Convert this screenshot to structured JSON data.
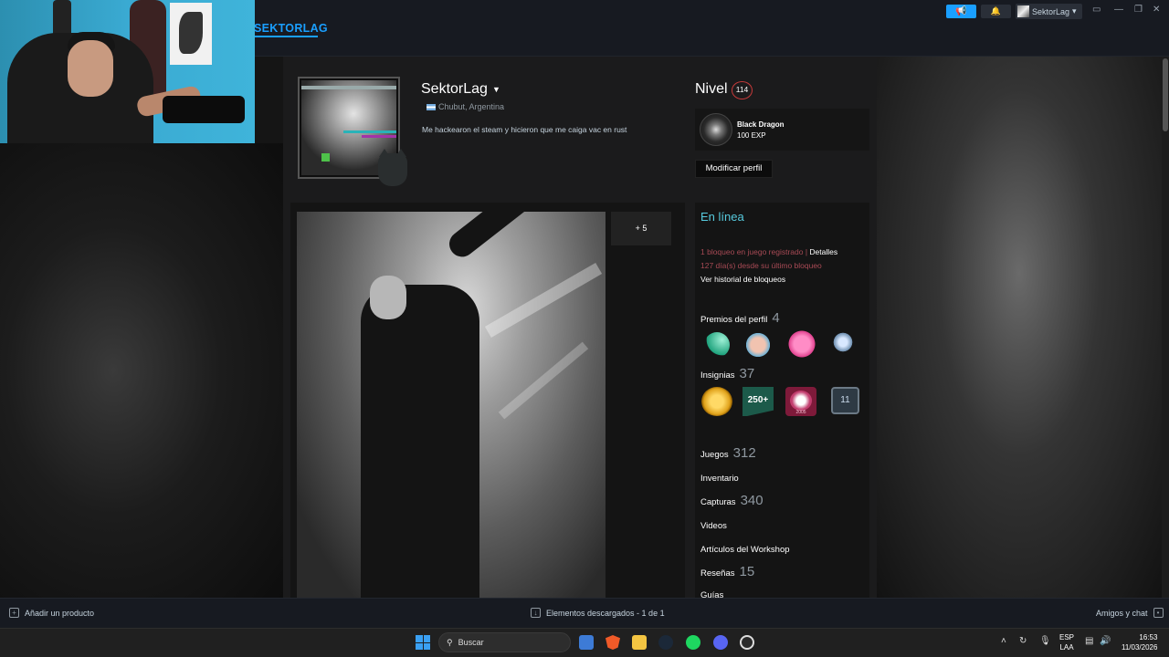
{
  "topbar": {
    "nav_title": "SEKTORLAG",
    "account_name": "SektorLag"
  },
  "profile": {
    "persona_name": "SektorLag",
    "location": "Chubut, Argentina",
    "summary": "Me hackearon el steam y hicieron que me caiga vac en rust",
    "level_label": "Nivel",
    "level": "114",
    "featured_badge": {
      "name": "Black Dragon",
      "xp": "100 EXP"
    },
    "edit_button": "Modificar perfil",
    "showcase_more": "+ 5"
  },
  "sidebar": {
    "status": "En línea",
    "ban_line1": "1 bloqueo en juego registrado | ",
    "ban_details": "Detalles",
    "ban_line2": "127 día(s) desde su último bloqueo",
    "ban_history": "Ver historial de bloqueos",
    "awards": {
      "label": "Premios del perfil",
      "count": "4"
    },
    "badges": {
      "label": "Insignias",
      "count": "37",
      "badge2_text": "250+",
      "badge3_year": "2005",
      "badge4_text": "11"
    },
    "games": {
      "label": "Juegos",
      "count": "312"
    },
    "inventory": {
      "label": "Inventario"
    },
    "screenshots": {
      "label": "Capturas",
      "count": "340"
    },
    "videos": {
      "label": "Videos"
    },
    "workshop": {
      "label": "Artículos del Workshop"
    },
    "reviews": {
      "label": "Reseñas",
      "count": "15"
    },
    "guides": {
      "label": "Guías"
    }
  },
  "bottombar": {
    "add_product": "Añadir un producto",
    "downloads": "Elementos descargados - 1 de 1",
    "friends": "Amigos y chat"
  },
  "taskbar": {
    "search_placeholder": "Buscar",
    "lang_top": "ESP",
    "lang_bottom": "LAA",
    "time": "16:53",
    "date": "11/03/2026"
  },
  "colors": {
    "steam_blue": "#1a9fff",
    "online": "#57cbde",
    "ban_red": "#a84a55",
    "level_ring": "#c73a3a"
  }
}
